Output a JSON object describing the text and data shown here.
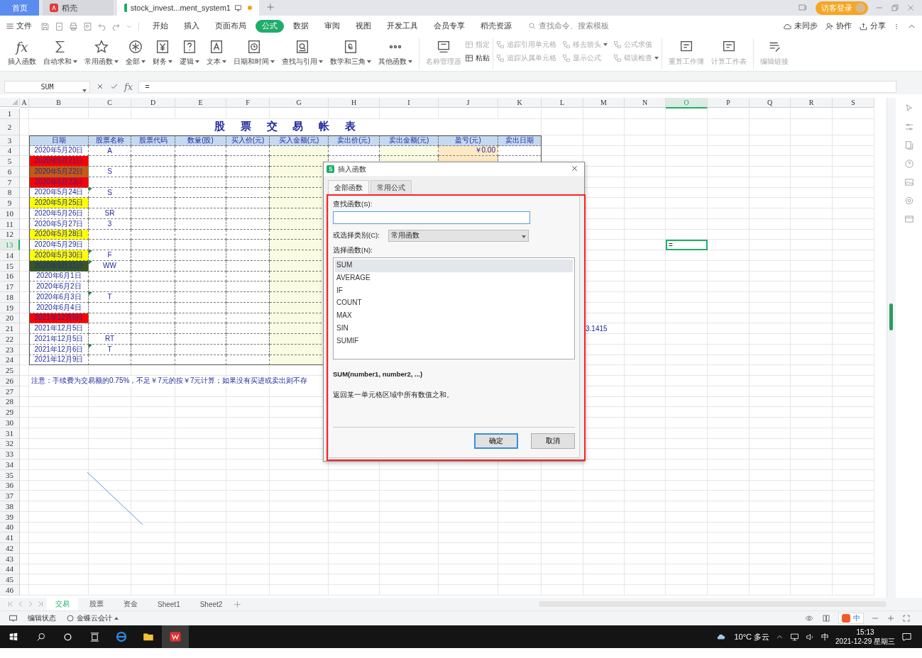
{
  "tabs": [
    {
      "label": "首页",
      "kind": "home",
      "selected": false
    },
    {
      "label": "稻壳",
      "kind": "app",
      "selected": false
    },
    {
      "label": "stock_invest...ment_system1",
      "kind": "doc",
      "selected": true
    }
  ],
  "title_bar": {
    "login": "访客登录"
  },
  "menu": {
    "file": "文件",
    "items": [
      {
        "label": "开始",
        "selected": false
      },
      {
        "label": "插入",
        "selected": false
      },
      {
        "label": "页面布局",
        "selected": false
      },
      {
        "label": "公式",
        "selected": true
      },
      {
        "label": "数据",
        "selected": false
      },
      {
        "label": "审阅",
        "selected": false
      },
      {
        "label": "视图",
        "selected": false
      },
      {
        "label": "开发工具",
        "selected": false
      },
      {
        "label": "会员专享",
        "selected": false
      },
      {
        "label": "稻壳资源",
        "selected": false
      }
    ],
    "search_placeholder": "查找命令、搜索模板",
    "actions": [
      {
        "label": "未同步",
        "kind": "cloud"
      },
      {
        "label": "协作",
        "kind": "person"
      },
      {
        "label": "分享",
        "kind": "share"
      }
    ]
  },
  "ribbon": {
    "functions": [
      {
        "label": "插入函数",
        "kind": "fx",
        "glyph": "fx",
        "dropdown": false
      },
      {
        "label": "自动求和",
        "kind": "sum",
        "dropdown": true
      },
      {
        "label": "常用函数",
        "kind": "star",
        "dropdown": true
      },
      {
        "label": "全部",
        "kind": "asterisk",
        "dropdown": true
      },
      {
        "label": "财务",
        "kind": "yen",
        "dropdown": true
      },
      {
        "label": "逻辑",
        "kind": "question",
        "dropdown": true
      },
      {
        "label": "文本",
        "kind": "letter",
        "dropdown": true
      },
      {
        "label": "日期和时间",
        "kind": "clock",
        "dropdown": true
      },
      {
        "label": "查找与引用",
        "kind": "lookup",
        "dropdown": true
      },
      {
        "label": "数学和三角",
        "kind": "math",
        "dropdown": true
      },
      {
        "label": "其他函数",
        "kind": "more",
        "dropdown": true
      }
    ],
    "name_manager": {
      "label": "名称管理器",
      "disabled": true
    },
    "names": [
      {
        "label": "指定",
        "disabled": true
      },
      {
        "label": "粘贴",
        "disabled": false
      }
    ],
    "audit": [
      {
        "label": "追踪引用单元格",
        "dropdown": false
      },
      {
        "label": "移去箭头",
        "dropdown": true
      },
      {
        "label": "公式求值",
        "dropdown": false
      },
      {
        "label": "追踪从属单元格",
        "dropdown": false
      },
      {
        "label": "显示公式",
        "dropdown": false
      },
      {
        "label": "错误检查",
        "dropdown": true
      }
    ],
    "calc": [
      {
        "label": "重算工作簿"
      },
      {
        "label": "计算工作表"
      }
    ],
    "links": {
      "label": "编辑链接"
    }
  },
  "formula_bar": {
    "name_box": "SUM",
    "formula": "=",
    "fx": "fx"
  },
  "sheet": {
    "columns": [
      {
        "label": "A",
        "selected": false
      },
      {
        "label": "B",
        "selected": false
      },
      {
        "label": "C",
        "selected": false
      },
      {
        "label": "D",
        "selected": false
      },
      {
        "label": "E",
        "selected": false
      },
      {
        "label": "F",
        "selected": false
      },
      {
        "label": "G",
        "selected": false
      },
      {
        "label": "H",
        "selected": false
      },
      {
        "label": "I",
        "selected": false
      },
      {
        "label": "J",
        "selected": false
      },
      {
        "label": "K",
        "selected": false
      },
      {
        "label": "L",
        "selected": false
      },
      {
        "label": "M",
        "selected": false
      },
      {
        "label": "N",
        "selected": false
      },
      {
        "label": "O",
        "selected": true
      },
      {
        "label": "P",
        "selected": false
      },
      {
        "label": "Q",
        "selected": false
      },
      {
        "label": "R",
        "selected": false
      },
      {
        "label": "S",
        "selected": false
      }
    ],
    "rows": [
      {
        "label": "1",
        "selected": false
      },
      {
        "label": "2",
        "selected": false
      },
      {
        "label": "3",
        "selected": false
      },
      {
        "label": "4",
        "selected": false
      },
      {
        "label": "5",
        "selected": false
      },
      {
        "label": "6",
        "selected": false
      },
      {
        "label": "7",
        "selected": false
      },
      {
        "label": "8",
        "selected": false
      },
      {
        "label": "9",
        "selected": false
      },
      {
        "label": "10",
        "selected": false
      },
      {
        "label": "11",
        "selected": false
      },
      {
        "label": "12",
        "selected": false
      },
      {
        "label": "13",
        "selected": true
      },
      {
        "label": "14",
        "selected": false
      },
      {
        "label": "15",
        "selected": false
      },
      {
        "label": "16",
        "selected": false
      },
      {
        "label": "17",
        "selected": false
      },
      {
        "label": "18",
        "selected": false
      },
      {
        "label": "19",
        "selected": false
      },
      {
        "label": "20",
        "selected": false
      },
      {
        "label": "21",
        "selected": false
      },
      {
        "label": "22",
        "selected": false
      },
      {
        "label": "23",
        "selected": false
      },
      {
        "label": "24",
        "selected": false
      },
      {
        "label": "25",
        "selected": false
      },
      {
        "label": "26",
        "selected": false
      },
      {
        "label": "27",
        "selected": false
      },
      {
        "label": "28",
        "selected": false
      },
      {
        "label": "29",
        "selected": false
      },
      {
        "label": "30",
        "selected": false
      },
      {
        "label": "31",
        "selected": false
      },
      {
        "label": "32",
        "selected": false
      },
      {
        "label": "33",
        "selected": false
      },
      {
        "label": "34",
        "selected": false
      },
      {
        "label": "35",
        "selected": false
      },
      {
        "label": "36",
        "selected": false
      },
      {
        "label": "37",
        "selected": false
      },
      {
        "label": "38",
        "selected": false
      },
      {
        "label": "39",
        "selected": false
      },
      {
        "label": "40",
        "selected": false
      },
      {
        "label": "41",
        "selected": false
      },
      {
        "label": "42",
        "selected": false
      },
      {
        "label": "43",
        "selected": false
      },
      {
        "label": "44",
        "selected": false
      },
      {
        "label": "45",
        "selected": false
      },
      {
        "label": "46",
        "selected": false
      }
    ],
    "title": "股 票 交 易 帐 表",
    "table": {
      "columns": [
        "日期",
        "股票名称",
        "股票代码",
        "数量(股)",
        "买入价(元)",
        "买入金额(元)",
        "卖出价(元)",
        "卖出金额(元)",
        "盈亏(元)",
        "卖出日期"
      ],
      "rows": [
        {
          "date": "2020年5月20日",
          "color": "#ffffff",
          "name": "A",
          "pnl": "￥0.00",
          "flag": false
        },
        {
          "date": "2020年5月21日",
          "color": "#ff0000",
          "flag": false
        },
        {
          "date": "2020年5月22日",
          "color": "#c55a11",
          "name": "S",
          "flag": false
        },
        {
          "date": "2020年5月23日",
          "color": "#ff0000",
          "flag": false
        },
        {
          "date": "2020年5月24日",
          "color": "#ffffff",
          "name": "S",
          "flag": true
        },
        {
          "date": "2020年5月25日",
          "color": "#ffff00",
          "flag": false
        },
        {
          "date": "2020年5月26日",
          "color": "#ffffff",
          "name": "SR",
          "flag": false
        },
        {
          "date": "2020年5月27日",
          "color": "#ffffff",
          "name": "3",
          "flag": false
        },
        {
          "date": "2020年5月28日",
          "color": "#ffff00",
          "flag": false
        },
        {
          "date": "2020年5月29日",
          "color": "#ffffff",
          "flag": false
        },
        {
          "date": "2020年5月30日",
          "color": "#ffff00",
          "name": "F",
          "flag": true
        },
        {
          "date": "2020年5月31日",
          "color": "#375623",
          "name": "WW",
          "flag": true
        },
        {
          "date": "2020年6月1日",
          "color": "#ffffff",
          "flag": false
        },
        {
          "date": "2020年6月2日",
          "color": "#ffffff",
          "flag": false
        },
        {
          "date": "2020年6月3日",
          "color": "#ffffff",
          "name": "T",
          "flag": true
        },
        {
          "date": "2020年6月4日",
          "color": "#ffffff",
          "flag": false
        },
        {
          "date": "2021年12月5日",
          "color": "#ff0000",
          "flag": false
        },
        {
          "date": "2021年12月5日",
          "color": "#ffffff",
          "flag": false
        },
        {
          "date": "2021年12月5日",
          "color": "#ffffff",
          "name": "RT",
          "flag": false
        },
        {
          "date": "2021年12月6日",
          "color": "#ffffff",
          "name": "T",
          "flag": true
        },
        {
          "date": "2021年12月9日",
          "color": "#ffffff",
          "flag": false
        }
      ]
    },
    "note": "注意：手续费为交易额的0.75%，不足￥7元的按￥7元计算；如果没有买进或卖出则不存",
    "value_cell": "3.1415",
    "active_cell": "="
  },
  "dialog": {
    "title": "插入函数",
    "tabs": [
      {
        "label": "全部函数",
        "selected": true
      },
      {
        "label": "常用公式",
        "selected": false
      }
    ],
    "search_label": "查找函数(S):",
    "category_label": "或选择类别(C):",
    "category": "常用函数",
    "list_label": "选择函数(N):",
    "functions": [
      {
        "label": "SUM",
        "selected": true
      },
      {
        "label": "AVERAGE",
        "selected": false
      },
      {
        "label": "IF",
        "selected": false
      },
      {
        "label": "COUNT",
        "selected": false
      },
      {
        "label": "MAX",
        "selected": false
      },
      {
        "label": "SIN",
        "selected": false
      },
      {
        "label": "SUMIF",
        "selected": false
      }
    ],
    "signature": "SUM(number1, number2, ...)",
    "description": "返回某一单元格区域中所有数值之和。",
    "ok": "确定",
    "cancel": "取消"
  },
  "sheet_tabs": [
    {
      "label": "交易",
      "selected": true
    },
    {
      "label": "股票",
      "selected": false
    },
    {
      "label": "资金",
      "selected": false
    },
    {
      "label": "Sheet1",
      "selected": false
    },
    {
      "label": "Sheet2",
      "selected": false
    }
  ],
  "status_bar": {
    "mode": "编辑状态",
    "plugin": "金蝶云会计",
    "ime": "中"
  },
  "taskbar": {
    "weather": "10°C 多云",
    "ime": "中",
    "time": "15:13",
    "date": "2021-12-29 星期三"
  }
}
